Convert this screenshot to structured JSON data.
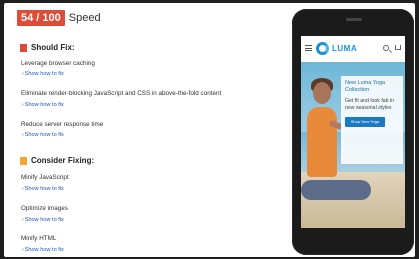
{
  "score": {
    "value": "54 / 100",
    "label": "Speed",
    "badge_color": "#dd4b39"
  },
  "should_fix": {
    "heading": "Should Fix:",
    "icon_color": "#dd4b39",
    "rules": [
      {
        "title": "Leverage browser caching",
        "link": "Show how to fix"
      },
      {
        "title": "Eliminate render-blocking JavaScript and CSS in above-the-fold content",
        "link": "Show how to fix"
      },
      {
        "title": "Reduce server response time",
        "link": "Show how to fix"
      }
    ]
  },
  "consider_fixing": {
    "heading": "Consider Fixing:",
    "icon_color": "#f4a533",
    "rules": [
      {
        "title": "Minify JavaScript",
        "link": "Show how to fix"
      },
      {
        "title": "Optimize images",
        "link": "Show how to fix"
      },
      {
        "title": "Minify HTML",
        "link": "Show how to fix"
      }
    ]
  },
  "preview": {
    "brand": "LUMA",
    "brand_color": "#1b8fd6",
    "promo_title": "New Luma Yoga Collection",
    "promo_text": "Get fit and look fab in new seasonal styles",
    "promo_button": "Shop New Yoga",
    "icons": [
      "menu-icon",
      "logo-icon",
      "search-icon",
      "cart-icon"
    ]
  }
}
